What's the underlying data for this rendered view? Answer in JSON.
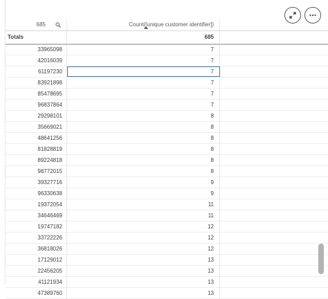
{
  "toolbar": {
    "expand_icon": "expand-icon",
    "more_icon": "more-options-icon"
  },
  "header": {
    "search_count": "685",
    "search_icon": "search-icon",
    "column2_label": "Count([unique customer identifier])"
  },
  "totals": {
    "label": "Totals",
    "value": "685"
  },
  "rows": [
    {
      "id": "33965098",
      "count": "7"
    },
    {
      "id": "42016039",
      "count": "7"
    },
    {
      "id": "61197230",
      "count": "7"
    },
    {
      "id": "83921898",
      "count": "7"
    },
    {
      "id": "85478695",
      "count": "7"
    },
    {
      "id": "96837864",
      "count": "7"
    },
    {
      "id": "29298101",
      "count": "8"
    },
    {
      "id": "35669021",
      "count": "8"
    },
    {
      "id": "48641256",
      "count": "8"
    },
    {
      "id": "81828819",
      "count": "8"
    },
    {
      "id": "89224818",
      "count": "8"
    },
    {
      "id": "98772015",
      "count": "8"
    },
    {
      "id": "39327716",
      "count": "9"
    },
    {
      "id": "96330638",
      "count": "9"
    },
    {
      "id": "19372054",
      "count": "11"
    },
    {
      "id": "34646469",
      "count": "11"
    },
    {
      "id": "19747182",
      "count": "12"
    },
    {
      "id": "33722226",
      "count": "12"
    },
    {
      "id": "36818026",
      "count": "12"
    },
    {
      "id": "17129012",
      "count": "13"
    },
    {
      "id": "22456205",
      "count": "13"
    },
    {
      "id": "41121934",
      "count": "13"
    },
    {
      "id": "47389760",
      "count": "13"
    }
  ],
  "selected_row_index": 2
}
